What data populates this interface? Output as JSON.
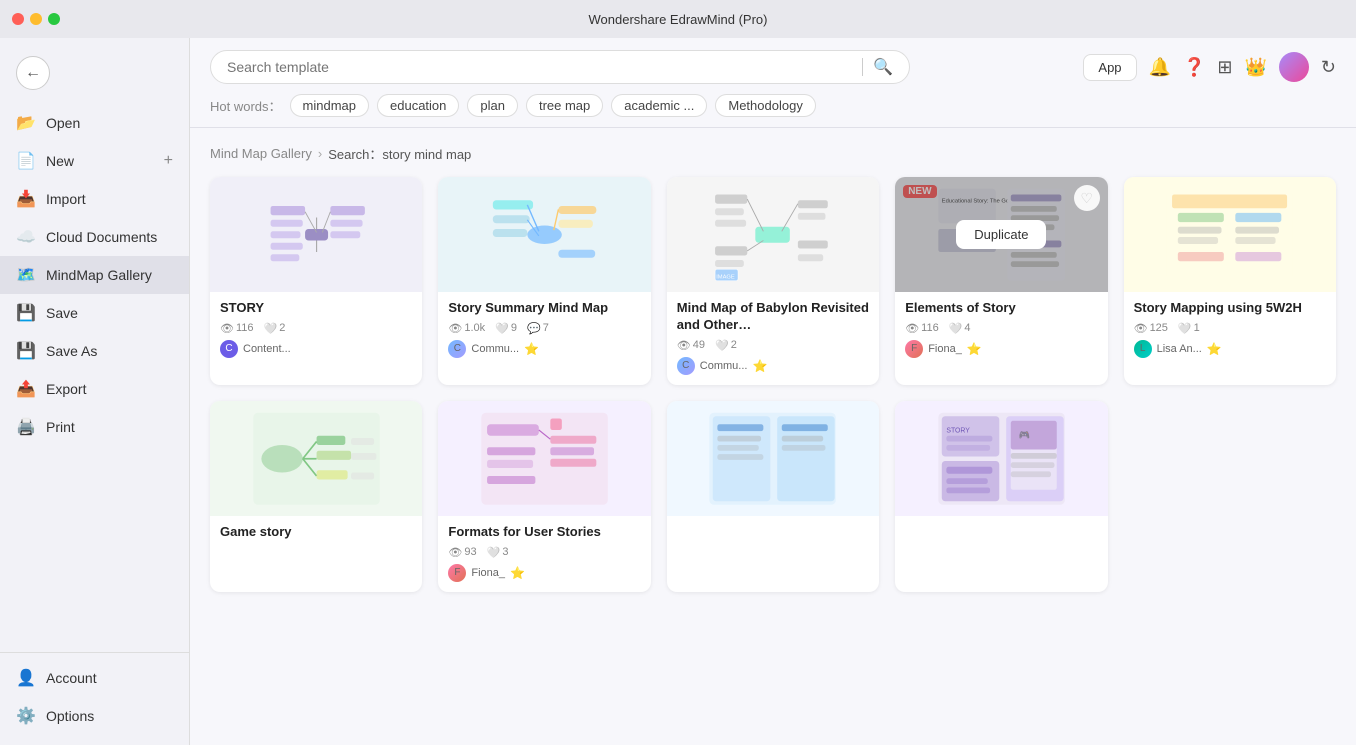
{
  "app": {
    "title": "Wondershare EdrawMind (Pro)"
  },
  "sidebar": {
    "back_label": "←",
    "items": [
      {
        "id": "open",
        "label": "Open",
        "icon": "📂"
      },
      {
        "id": "new",
        "label": "New",
        "icon": "📄",
        "has_plus": true
      },
      {
        "id": "import",
        "label": "Import",
        "icon": "📥"
      },
      {
        "id": "cloud",
        "label": "Cloud Documents",
        "icon": "☁️"
      },
      {
        "id": "mindmap-gallery",
        "label": "MindMap Gallery",
        "icon": "🗺️",
        "active": true
      },
      {
        "id": "save",
        "label": "Save",
        "icon": "💾"
      },
      {
        "id": "save-as",
        "label": "Save As",
        "icon": "💾"
      },
      {
        "id": "export",
        "label": "Export",
        "icon": "📤"
      },
      {
        "id": "print",
        "label": "Print",
        "icon": "🖨️"
      }
    ],
    "bottom_items": [
      {
        "id": "account",
        "label": "Account",
        "icon": "👤"
      },
      {
        "id": "options",
        "label": "Options",
        "icon": "⚙️"
      }
    ]
  },
  "header": {
    "search_placeholder": "Search template",
    "app_btn": "App",
    "hot_words_label": "Hot words：",
    "hot_tags": [
      "mindmap",
      "education",
      "plan",
      "tree map",
      "academic ...",
      "Methodology"
    ]
  },
  "breadcrumb": {
    "root": "Mind Map Gallery",
    "separator": "›",
    "search_prefix": "Search：",
    "search_query": "story mind map"
  },
  "gallery": {
    "cards": [
      {
        "id": "story",
        "title": "STORY",
        "thumb_style": "story",
        "views": "116",
        "likes": "2",
        "author": "Content...",
        "author_style": "c",
        "is_pro": false,
        "has_overlay": false,
        "has_new": false
      },
      {
        "id": "story-summary",
        "title": "Story Summary Mind Map",
        "thumb_style": "summary",
        "views": "1.0k",
        "likes": "9",
        "comments": "7",
        "author": "Commu...",
        "author_style": "comm",
        "is_pro": true,
        "has_overlay": false,
        "has_new": false
      },
      {
        "id": "babylon",
        "title": "Mind Map of Babylon Revisited and Other…",
        "thumb_style": "babylon",
        "views": "49",
        "likes": "2",
        "author": "Commu...",
        "author_style": "comm",
        "is_pro": true,
        "has_overlay": false,
        "has_new": false
      },
      {
        "id": "elements",
        "title": "Elements of Story",
        "thumb_style": "elements",
        "views": "116",
        "likes": "4",
        "author": "Fiona_",
        "author_style": "fiona",
        "is_pro": true,
        "has_overlay": true,
        "has_new": true,
        "overlay_btn": "Duplicate"
      },
      {
        "id": "5w2h",
        "title": "Story Mapping using 5W2H",
        "thumb_style": "5w2h",
        "views": "125",
        "likes": "1",
        "author": "Lisa An...",
        "author_style": "lisa",
        "is_pro": true,
        "has_overlay": false,
        "has_new": false
      },
      {
        "id": "game-story",
        "title": "Game story",
        "thumb_style": "game",
        "views": "",
        "likes": "",
        "author": "",
        "author_style": "",
        "is_pro": false,
        "has_overlay": false,
        "has_new": false
      },
      {
        "id": "formats-user-stories",
        "title": "Formats for User Stories",
        "thumb_style": "formats",
        "views": "93",
        "likes": "3",
        "author": "Fiona_",
        "author_style": "fiona",
        "is_pro": true,
        "has_overlay": false,
        "has_new": false
      },
      {
        "id": "mind-col2",
        "title": "",
        "thumb_style": "col2",
        "views": "",
        "likes": "",
        "author": "",
        "author_style": "",
        "is_pro": false,
        "has_overlay": false,
        "has_new": false
      },
      {
        "id": "mind-col3",
        "title": "",
        "thumb_style": "col3",
        "views": "",
        "likes": "",
        "author": "",
        "author_style": "",
        "is_pro": false,
        "has_overlay": false,
        "has_new": false
      }
    ]
  }
}
